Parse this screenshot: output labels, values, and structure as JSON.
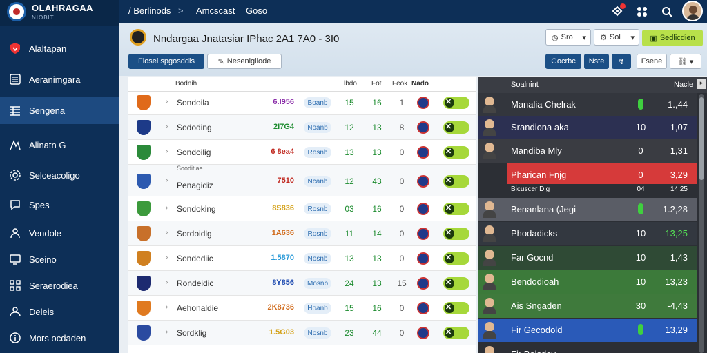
{
  "brand": {
    "title": "OLAHRAGAA",
    "subtitle": "NIOBIT"
  },
  "sidebar": {
    "items": [
      {
        "label": "Alaltapan",
        "icon": "shield-icon"
      },
      {
        "label": "Aeranimgara",
        "icon": "list-icon"
      },
      {
        "label": "Sengena",
        "icon": "table-icon"
      },
      {
        "label": "Alinatn G",
        "icon": "chart-icon"
      },
      {
        "label": "Selceacoligo",
        "icon": "settings-icon"
      },
      {
        "label": "Spes",
        "icon": "chat-icon"
      },
      {
        "label": "Vendole",
        "icon": "user-icon"
      },
      {
        "label": "Sceino",
        "icon": "monitor-icon"
      },
      {
        "label": "Seraerodiea",
        "icon": "grid-icon"
      },
      {
        "label": "Deleis",
        "icon": "users-icon"
      },
      {
        "label": "Mors ocdaden",
        "icon": "info-icon"
      }
    ]
  },
  "topbar": {
    "breadcrumb_1": "Berlinods",
    "separator": ">",
    "breadcrumb_2": "Amcscast",
    "breadcrumb_3": "Goso"
  },
  "header": {
    "title": "Nndargaa Jnatasiar  IPhac 2A1 7A0 - 3I0",
    "button_1": "Flosel spgosddis",
    "button_2": "Nesenigiiode",
    "select_1": "Sro",
    "select_2": "Sol",
    "button_green": "Sedlicdien",
    "button_a": "Gocrbc",
    "button_b": "Nste",
    "button_c": "Fsene"
  },
  "table": {
    "headers": {
      "name": "Bodnih",
      "c1": "lbdo",
      "c2": "Fot",
      "c3": "Feok",
      "c4": "Nado"
    },
    "rows": [
      {
        "name": "Sondoila",
        "sub": "",
        "code": "6.I956",
        "code_color": "#8a2da8",
        "pill": "Boanb",
        "v1": "15",
        "v2": "16",
        "v3": "1",
        "crest": "#e06a1a"
      },
      {
        "name": "Sododing",
        "sub": "",
        "code": "2I7G4",
        "code_color": "#1c8b2e",
        "pill": "Noanb",
        "v1": "12",
        "v2": "13",
        "v3": "8",
        "crest": "#1d3a88"
      },
      {
        "name": "Sondoilig",
        "sub": "",
        "code": "6 8ea4",
        "code_color": "#c0281f",
        "pill": "Rosnb",
        "v1": "13",
        "v2": "13",
        "v3": "0",
        "crest": "#2b8a3a"
      },
      {
        "name": "Penagidiz",
        "sub": "Sooditiae",
        "code": "7510",
        "code_color": "#c0281f",
        "pill": "Ncanb",
        "v1": "12",
        "v2": "43",
        "v3": "0",
        "crest": "#2d5ab0"
      },
      {
        "name": "Sondoking",
        "sub": "",
        "code": "8S836",
        "code_color": "#d4a21a",
        "pill": "Rosnb",
        "v1": "03",
        "v2": "16",
        "v3": "0",
        "crest": "#3c9a3c"
      },
      {
        "name": "Sordoidlg",
        "sub": "",
        "code": "1A636",
        "code_color": "#d06a1a",
        "pill": "Rosnb",
        "v1": "11",
        "v2": "14",
        "v3": "0",
        "crest": "#c8702a"
      },
      {
        "name": "Sondediic",
        "sub": "",
        "code": "1.5870",
        "code_color": "#2a9ad8",
        "pill": "Nosnb",
        "v1": "13",
        "v2": "13",
        "v3": "0",
        "crest": "#d08020"
      },
      {
        "name": "Rondeidic",
        "sub": "",
        "code": "8Y856",
        "code_color": "#1d4ab0",
        "pill": "Mosnb",
        "v1": "24",
        "v2": "13",
        "v3": "15",
        "crest": "#1d2a70"
      },
      {
        "name": "Aehonaldie",
        "sub": "",
        "code": "2K8736",
        "code_color": "#d06a1a",
        "pill": "Hoanb",
        "v1": "15",
        "v2": "16",
        "v3": "0",
        "crest": "#e07a20"
      },
      {
        "name": "Sordklig",
        "sub": "",
        "code": "1.5G03",
        "code_color": "#d4a21a",
        "pill": "Nosnb",
        "v1": "23",
        "v2": "44",
        "v3": "0",
        "crest": "#2a4aa0"
      }
    ]
  },
  "panel": {
    "headers": {
      "name": "Soalnint",
      "value": "Nacle"
    },
    "rows": [
      {
        "name": "Manalia Chelrak",
        "v1": "",
        "v2": "1.,44",
        "bg": "#33363d",
        "dot": true,
        "v2color": "#ffffff"
      },
      {
        "name": "Srandiona aka",
        "v1": "10",
        "v2": "1,07",
        "bg": "#2c3052",
        "dot": false,
        "v2color": "#ffffff"
      },
      {
        "name": "Mandiba Mly",
        "v1": "0",
        "v2": "1,31",
        "bg": "#3a3c42",
        "dot": false,
        "v2color": "#ffffff"
      },
      {
        "name": "Pharican Fnjg",
        "v1": "0",
        "v2": "3,29",
        "bg": "#d63a3a",
        "dot": false,
        "v2color": "#ffffff"
      },
      {
        "name": "Bicuscer Djg",
        "v1": "04",
        "v2": "14,25",
        "bg": "#2c2f35",
        "dot": false,
        "v2color": "#ffffff"
      },
      {
        "name": "Benanlana (Jegi",
        "v1": "",
        "v2": "1.2,28",
        "bg": "#5a5d66",
        "dot": true,
        "v2color": "#ffffff"
      },
      {
        "name": "Phodadicks",
        "v1": "10",
        "v2": "13,25",
        "bg": "#333840",
        "dot": false,
        "v2color": "#55e055"
      },
      {
        "name": "Far Gocnd",
        "v1": "10",
        "v2": "1,43",
        "bg": "#2f4a35",
        "dot": false,
        "v2color": "#ffffff"
      },
      {
        "name": "Bendodioah",
        "v1": "10",
        "v2": "13,23",
        "bg": "#3c7a3a",
        "dot": false,
        "v2color": "#ffffff"
      },
      {
        "name": "Ais Sngaden",
        "v1": "30",
        "v2": "-4,43",
        "bg": "#3f7a3c",
        "dot": false,
        "v2color": "#ffffff"
      },
      {
        "name": "Fir Gecodold",
        "v1": "",
        "v2": "13,29",
        "bg": "#2a5ab8",
        "dot": true,
        "v2color": "#ffffff"
      },
      {
        "name": "Fir Bolsdoy",
        "v1": "",
        "v2": "",
        "bg": "#2c2f35",
        "dot": false,
        "v2color": "#ffffff"
      }
    ]
  }
}
